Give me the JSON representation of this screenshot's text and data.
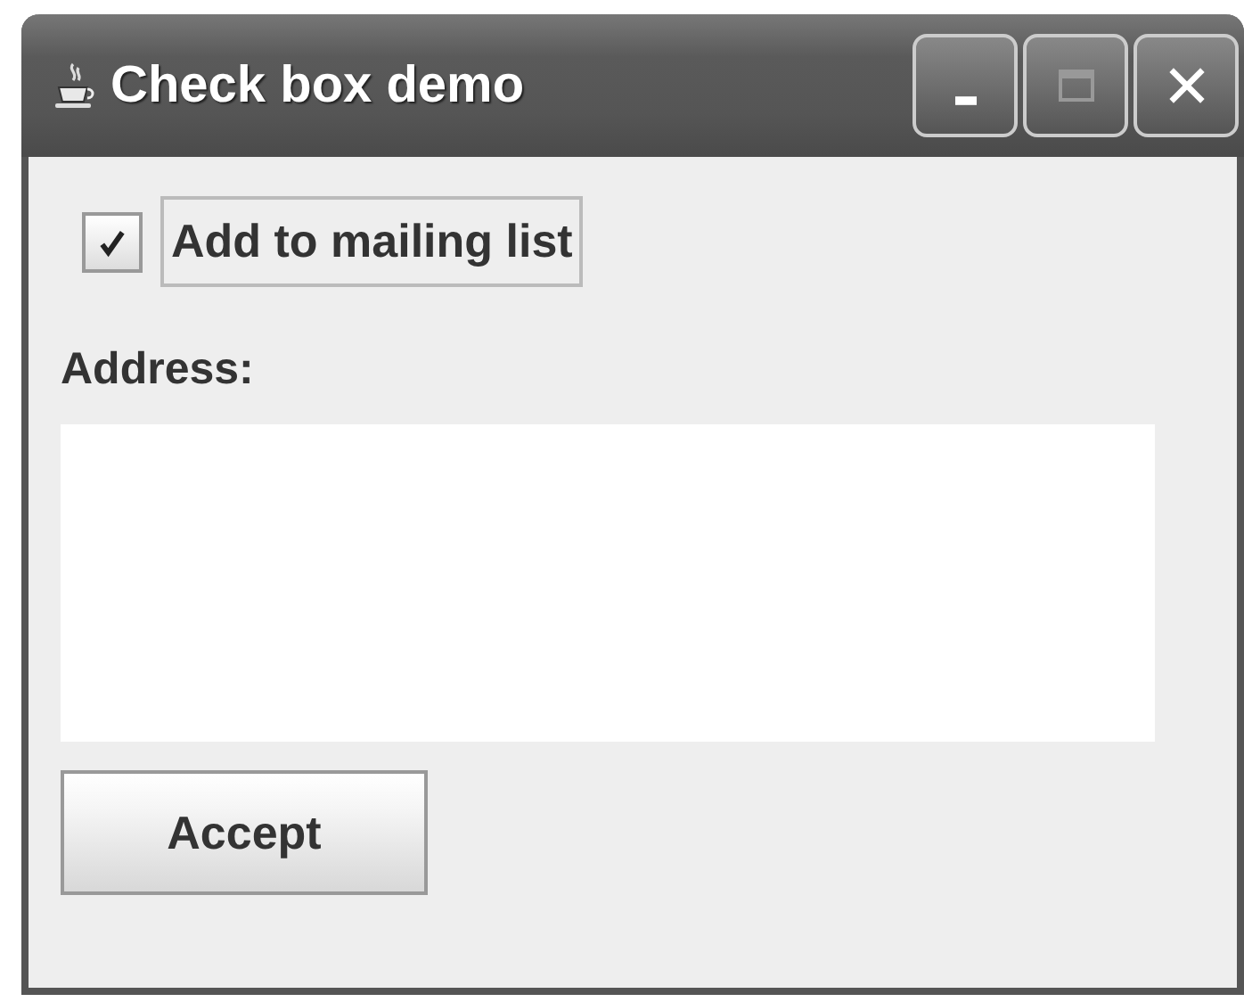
{
  "window": {
    "title": "Check box demo"
  },
  "checkbox": {
    "label": "Add to mailing list",
    "checked": true,
    "focused": true
  },
  "address": {
    "label": "Address:"
  },
  "buttons": [
    "Accept"
  ]
}
